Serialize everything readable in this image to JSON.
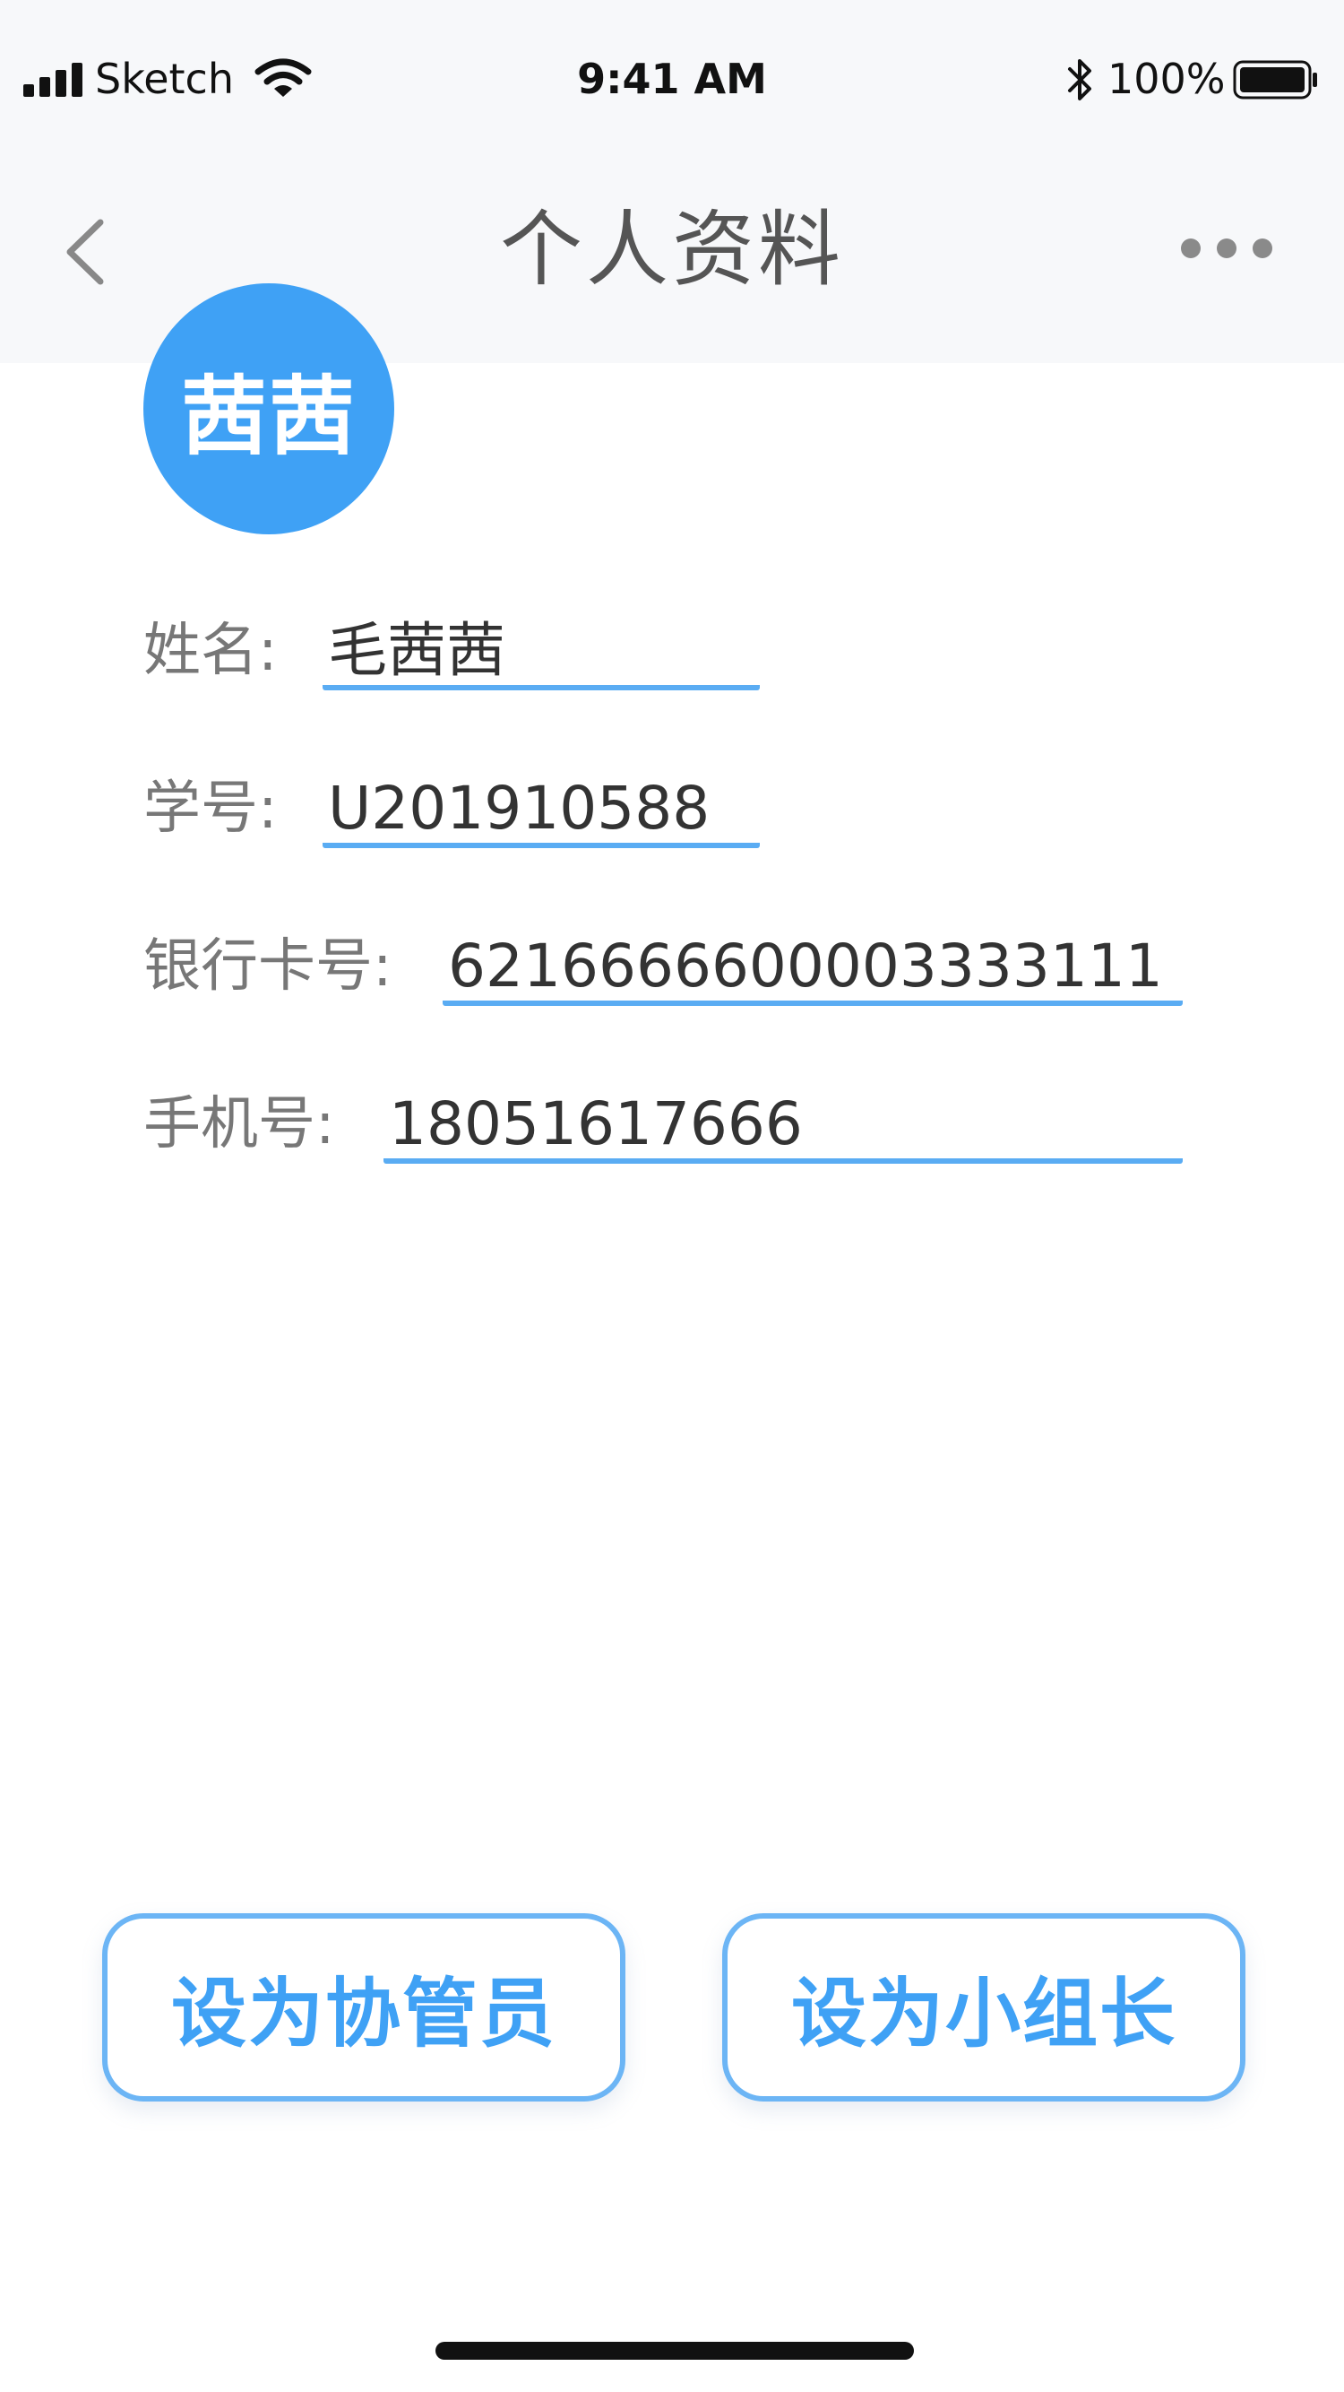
{
  "status_bar": {
    "carrier": "Sketch",
    "time": "9:41 AM",
    "battery": "100%"
  },
  "nav": {
    "title": "个人资料",
    "back_icon": "chevron-left-icon",
    "more_icon": "more-horizontal-icon"
  },
  "profile": {
    "avatar_text": "茜茜",
    "avatar_color": "#3fa1f5"
  },
  "fields": {
    "name": {
      "label": "姓名:",
      "value": "毛茜茜"
    },
    "student_id": {
      "label": "学号:",
      "value": "U201910588"
    },
    "bank_card": {
      "label": "银行卡号:",
      "value": "6216666600003333111"
    },
    "phone": {
      "label": "手机号:",
      "value": "18051617666"
    }
  },
  "actions": {
    "set_assistant": "设为协管员",
    "set_leader": "设为小组长"
  },
  "colors": {
    "accent": "#3fa1f5",
    "underline": "#5aacf3",
    "header_bg": "#f7f8fa"
  }
}
